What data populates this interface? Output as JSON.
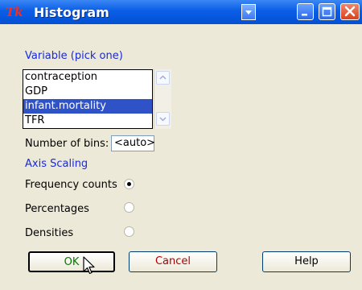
{
  "window": {
    "title": "Histogram",
    "app_logo": "Tk"
  },
  "variable_section": {
    "label": "Variable (pick one)",
    "items": [
      "contraception",
      "GDP",
      "infant.mortality",
      "TFR"
    ],
    "selected": "infant.mortality"
  },
  "bins": {
    "label": "Number of bins:",
    "value": "<auto>"
  },
  "axis_scaling": {
    "label": "Axis Scaling",
    "options": [
      {
        "label": "Frequency counts",
        "selected": true
      },
      {
        "label": "Percentages",
        "selected": false
      },
      {
        "label": "Densities",
        "selected": false
      }
    ]
  },
  "buttons": {
    "ok": "OK",
    "cancel": "Cancel",
    "help": "Help"
  },
  "colors": {
    "titlebar": "#0350d3",
    "section_label": "#1a2ad8",
    "selection": "#2f53c7",
    "ok_text": "#007a00",
    "cancel_text": "#b00000"
  }
}
